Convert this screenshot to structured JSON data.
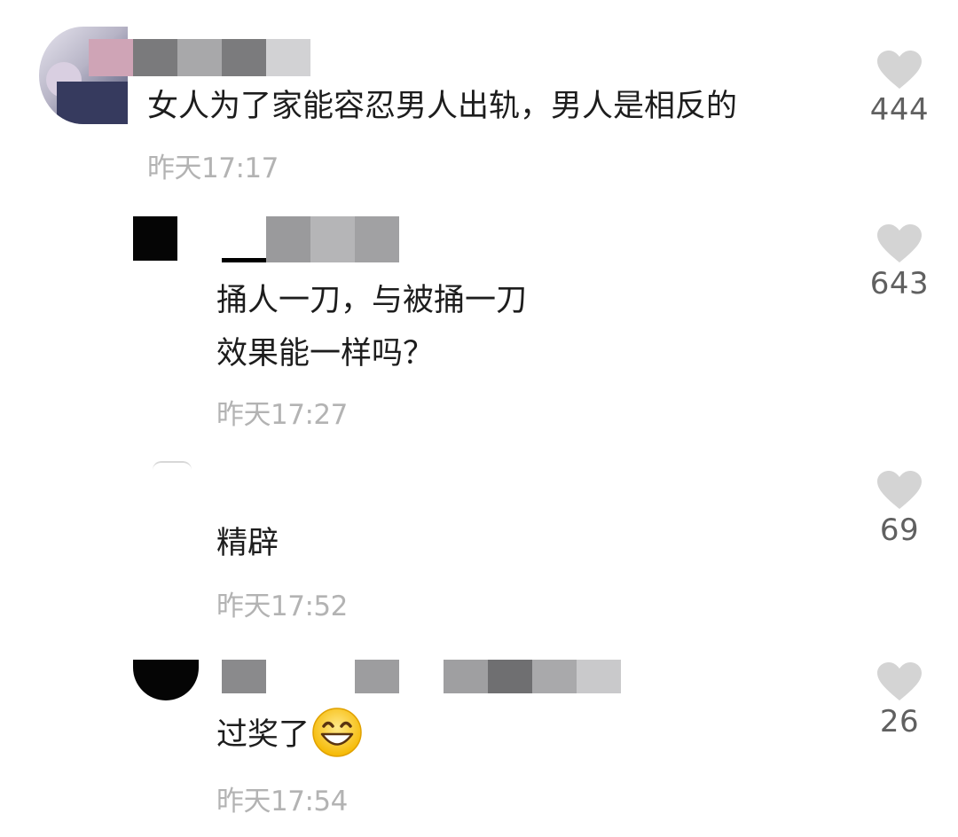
{
  "comments": [
    {
      "text": "女人为了家能容忍男人出轨，男人是相反的",
      "time": "昨天17:17",
      "likes": "444",
      "heart_color": "#d4d4d4"
    },
    {
      "lines": [
        "捅人一刀，与被捅一刀",
        "效果能一样吗？"
      ],
      "time": "昨天17:27",
      "likes": "643"
    },
    {
      "text": "精辟",
      "time": "昨天17:52",
      "likes": "69"
    },
    {
      "text": "过奖了",
      "emoji": "grinning-face-emoji",
      "time": "昨天17:54",
      "likes": "26"
    }
  ]
}
